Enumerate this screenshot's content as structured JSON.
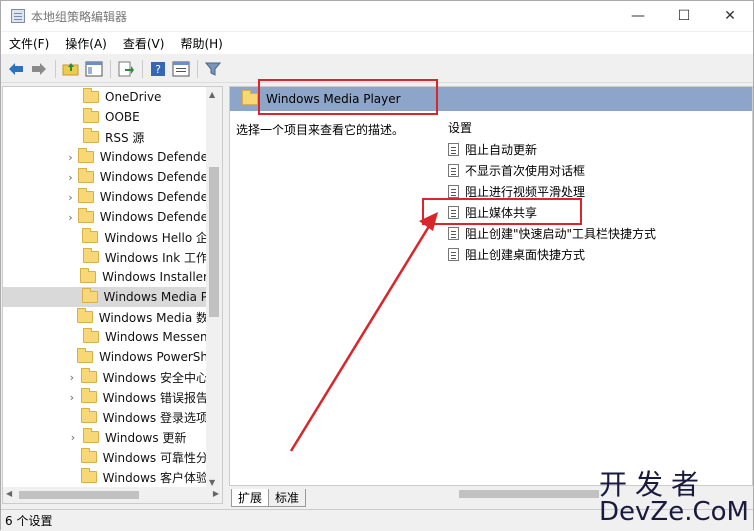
{
  "window": {
    "title": "本地组策略编辑器",
    "controls": {
      "minimize": "—",
      "maximize": "☐",
      "close": "✕"
    }
  },
  "menu": [
    {
      "label": "文件(F)"
    },
    {
      "label": "操作(A)"
    },
    {
      "label": "查看(V)"
    },
    {
      "label": "帮助(H)"
    }
  ],
  "tree": {
    "items": [
      {
        "label": "OneDrive",
        "expandable": false
      },
      {
        "label": "OOBE",
        "expandable": false
      },
      {
        "label": "RSS 源",
        "expandable": false
      },
      {
        "label": "Windows Defende",
        "expandable": true
      },
      {
        "label": "Windows Defende",
        "expandable": true
      },
      {
        "label": "Windows Defende",
        "expandable": true
      },
      {
        "label": "Windows Defende",
        "expandable": true
      },
      {
        "label": "Windows Hello 企",
        "expandable": false
      },
      {
        "label": "Windows Ink 工作",
        "expandable": false
      },
      {
        "label": "Windows Installer",
        "expandable": false
      },
      {
        "label": "Windows Media P",
        "expandable": false,
        "selected": true
      },
      {
        "label": "Windows Media 数",
        "expandable": false
      },
      {
        "label": "Windows Messen",
        "expandable": false
      },
      {
        "label": "Windows PowerSh",
        "expandable": false
      },
      {
        "label": "Windows 安全中心",
        "expandable": true
      },
      {
        "label": "Windows 错误报告",
        "expandable": true
      },
      {
        "label": "Windows 登录选项",
        "expandable": false
      },
      {
        "label": "Windows 更新",
        "expandable": true
      },
      {
        "label": "Windows 可靠性分",
        "expandable": false
      },
      {
        "label": "Windows 客户体验",
        "expandable": false
      }
    ]
  },
  "content": {
    "header_title": "Windows Media Player",
    "description": "选择一个项目来查看它的描述。",
    "settings_heading": "设置",
    "policies": [
      {
        "label": "阻止自动更新"
      },
      {
        "label": "不显示首次使用对话框"
      },
      {
        "label": "阻止进行视频平滑处理"
      },
      {
        "label": "阻止媒体共享"
      },
      {
        "label": "阻止创建\"快速启动\"工具栏快捷方式"
      },
      {
        "label": "阻止创建桌面快捷方式"
      }
    ]
  },
  "tabs": [
    {
      "label": "扩展"
    },
    {
      "label": "标准"
    }
  ],
  "status": {
    "text": "6 个设置"
  },
  "watermark": {
    "cn": "开发者",
    "en": "DevZe.CoM"
  },
  "colors": {
    "highlight": "#d9262b",
    "header_bar": "#8ca5c8",
    "selected_row": "#d9d9d9"
  }
}
